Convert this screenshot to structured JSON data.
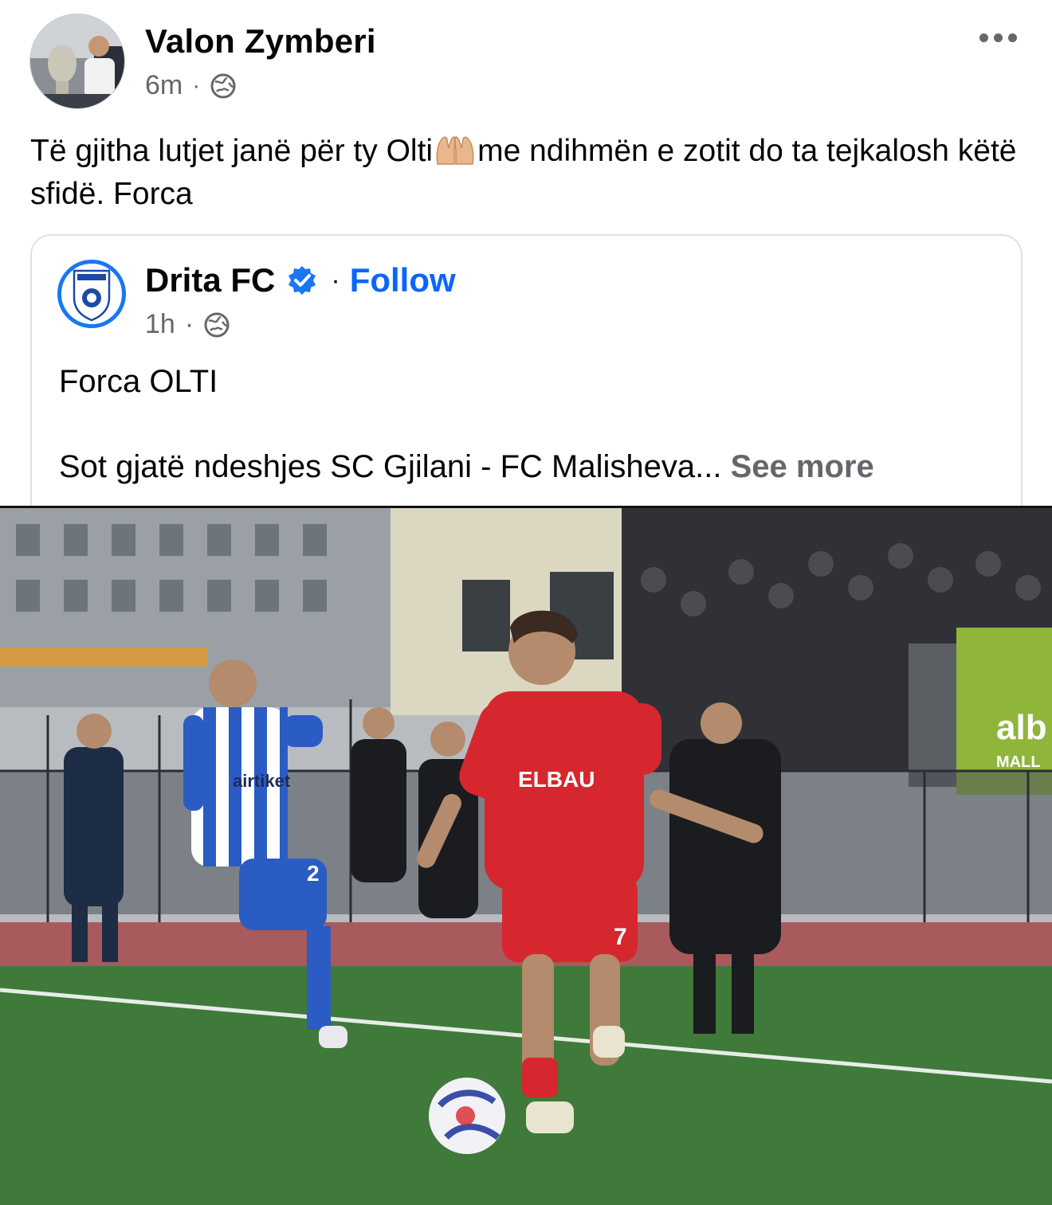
{
  "post": {
    "author": "Valon Zymberi",
    "time": "6m",
    "separator": "·",
    "text_before_emoji": "Të gjitha lutjet janë për ty Olti",
    "emoji": "praying-hands-emoji",
    "text_after_emoji": "me ndihmën e zotit do ta tejkalosh këtë sfidë. Forca"
  },
  "shared": {
    "page_name": "Drita FC",
    "separator": "·",
    "follow_label": "Follow",
    "time": "1h",
    "line1": "Forca OLTI",
    "line2": "Sot gjatë ndeshjes SC Gjilani - FC Malisheva...",
    "see_more": "See more",
    "photo": {
      "jersey_text_red": "ELBAU",
      "jersey_number_red": "7",
      "jersey_text_blue": "airtiket",
      "jersey_number_blue": "2",
      "banner_text": "alb",
      "banner_sub": "MALL"
    }
  },
  "colors": {
    "link_blue": "#0866ff",
    "secondary_text": "#65676b",
    "verified_blue": "#1877f2",
    "border": "#dfe1e5"
  },
  "icons": {
    "more": "more-options-icon",
    "globe": "public-globe-icon",
    "verified": "verified-badge-icon"
  }
}
